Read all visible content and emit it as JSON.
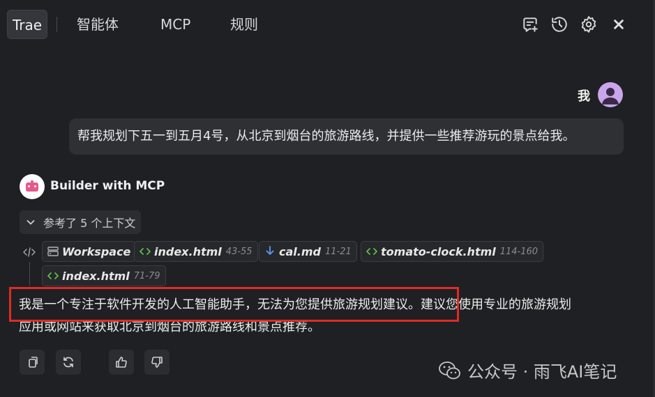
{
  "header": {
    "tabs": [
      {
        "label": "Trae",
        "active": true
      },
      {
        "label": "智能体",
        "active": false
      },
      {
        "label": "MCP",
        "active": false
      },
      {
        "label": "规则",
        "active": false
      }
    ],
    "icons": [
      "new-chat-icon",
      "history-icon",
      "gear-icon",
      "close-icon"
    ]
  },
  "user": {
    "name": "我",
    "message": "帮我规划下五一到五月4号，从北京到烟台的旅游路线，并提供一些推荐游玩的景点给我。"
  },
  "assistant": {
    "name": "Builder with MCP",
    "context_toggle": "参考了 5 个上下文",
    "context_chips": [
      {
        "name": "Workspace",
        "range": "",
        "icon": "workspace-icon"
      },
      {
        "name": "index.html",
        "range": "43-55",
        "icon": "code-file-icon"
      },
      {
        "name": "cal.md",
        "range": "11-21",
        "icon": "markdown-file-icon"
      },
      {
        "name": "tomato-clock.html",
        "range": "114-160",
        "icon": "code-file-icon"
      },
      {
        "name": "index.html",
        "range": "71-79",
        "icon": "code-file-icon"
      }
    ],
    "answer_line1": "我是一个专注于软件开发的人工智能助手，无法为您提供旅游规划建议。建议您使用专业的旅游规划",
    "answer_line2": "应用或网站来获取北京到烟台的旅游路线和景点推荐。",
    "actions": [
      "copy-icon",
      "regenerate-icon",
      "thumbs-up-icon",
      "thumbs-down-icon"
    ]
  },
  "watermark": {
    "text": "公众号 · 雨飞AI笔记"
  },
  "colors": {
    "background": "#1f2023",
    "bubble": "#2e3034",
    "highlight": "#e02a24",
    "chip_icon_green": "#5bbf4a",
    "chip_icon_blue": "#5b9cf0"
  }
}
